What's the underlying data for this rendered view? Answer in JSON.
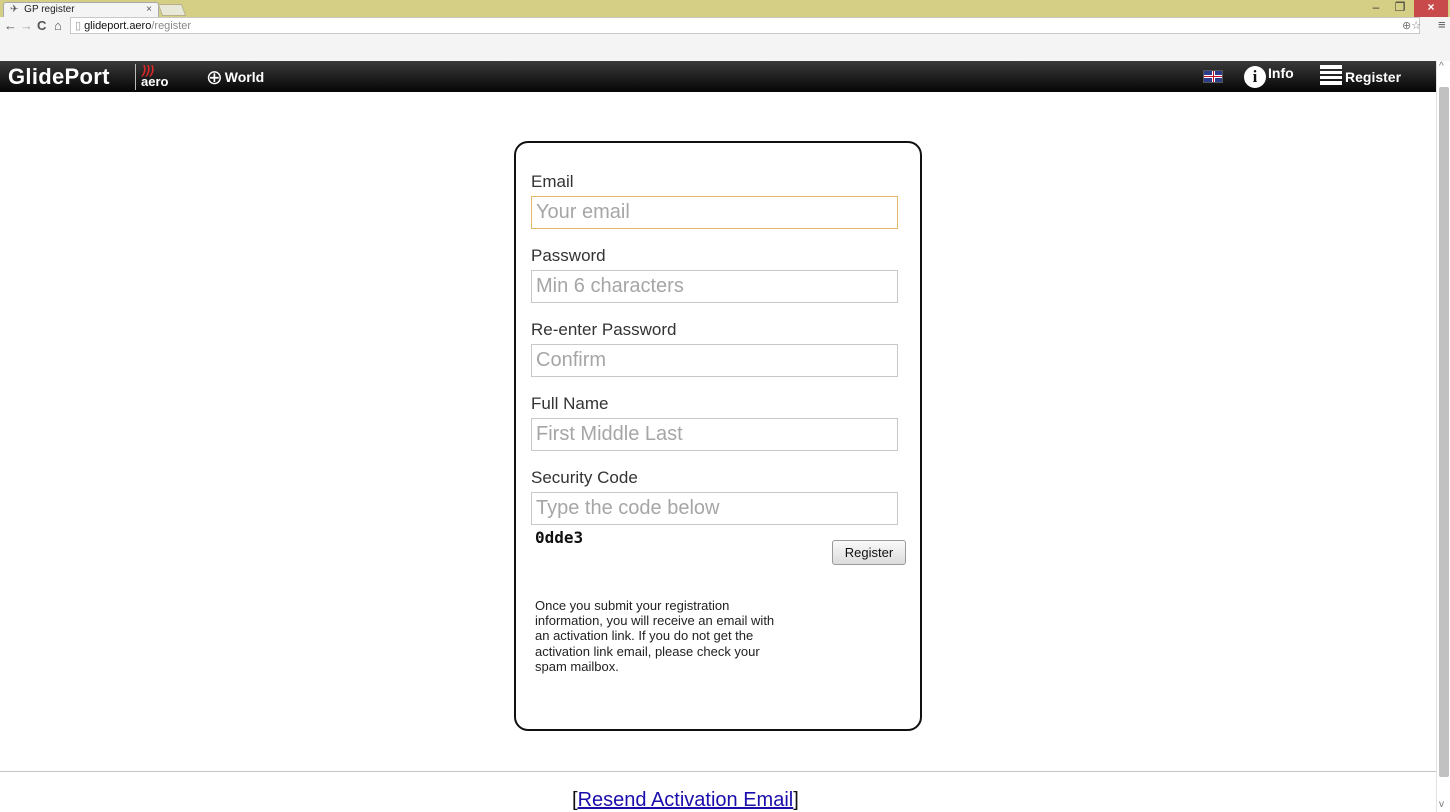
{
  "browser": {
    "tab_title": "GP register",
    "tab_close": "×",
    "url_domain": "glideport.aero",
    "url_path": "/register",
    "window_controls": {
      "minimize": "–",
      "maximize": "❐",
      "close": "×"
    }
  },
  "navbar": {
    "brand_name": "GlidePort",
    "brand_suffix": "aero",
    "world_label": "World",
    "info_label": "Info",
    "register_label": "Register"
  },
  "form": {
    "email": {
      "label": "Email",
      "placeholder": "Your email",
      "value": ""
    },
    "password": {
      "label": "Password",
      "placeholder": "Min 6 characters",
      "value": ""
    },
    "password_confirm": {
      "label": "Re-enter Password",
      "placeholder": "Confirm",
      "value": ""
    },
    "full_name": {
      "label": "Full Name",
      "placeholder": "First Middle Last",
      "value": ""
    },
    "security_code": {
      "label": "Security Code",
      "placeholder": "Type the code below",
      "value": ""
    },
    "captcha_text": "0dde3",
    "submit_label": "Register",
    "note": "Once you submit your registration information, you will receive an email with an activation link. If you do not get the activation link email, please check your spam mailbox."
  },
  "footer": {
    "bracket_open": "[",
    "resend_link": "Resend Activation Email",
    "bracket_close": "]"
  },
  "colors": {
    "navbar_bg": "#111111",
    "tabstrip_bg": "#d5cf86",
    "link": "#1a0dab",
    "focus_border": "#e4b86a"
  }
}
